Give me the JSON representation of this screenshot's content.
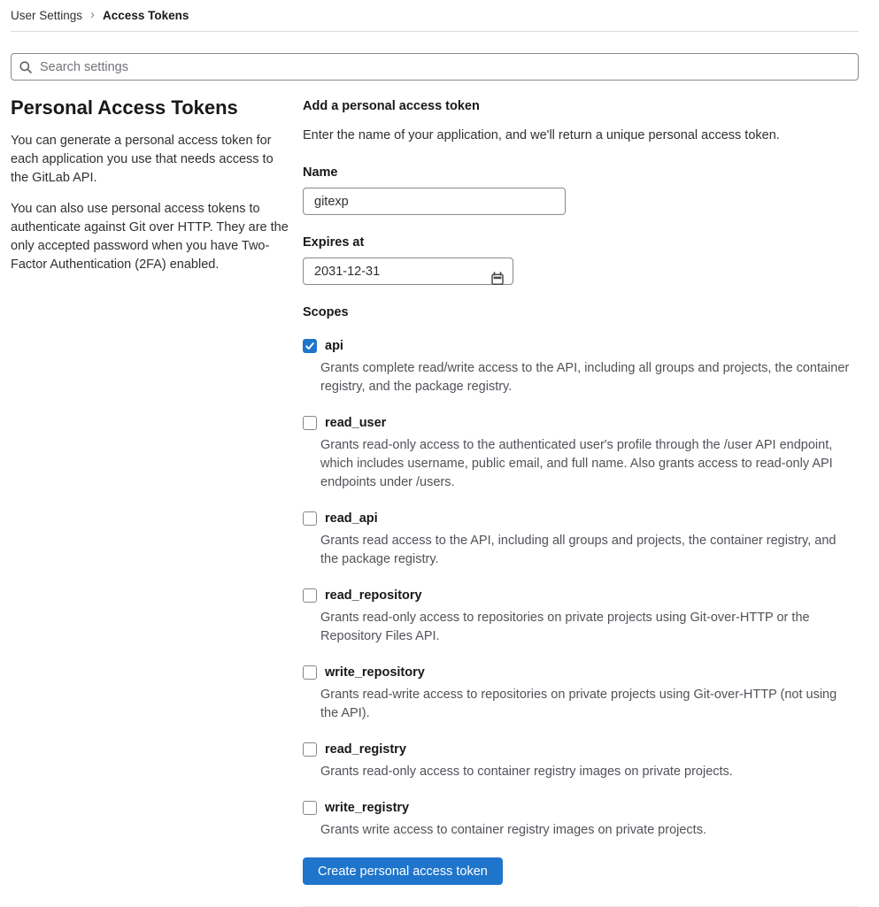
{
  "breadcrumb": {
    "separator": "›",
    "items": [
      {
        "label": "User Settings"
      },
      {
        "label": "Access Tokens"
      }
    ]
  },
  "search": {
    "placeholder": "Search settings"
  },
  "sidebar": {
    "title": "Personal Access Tokens",
    "paragraphs": [
      "You can generate a personal access token for each application you use that needs access to the GitLab API.",
      "You can also use personal access tokens to authenticate against Git over HTTP. They are the only accepted password when you have Two-Factor Authentication (2FA) enabled."
    ]
  },
  "form": {
    "title": "Add a personal access token",
    "description": "Enter the name of your application, and we'll return a unique personal access token.",
    "name_label": "Name",
    "name_value": "gitexp",
    "expires_label": "Expires at",
    "expires_value": "2031-12-31",
    "scopes_label": "Scopes",
    "scopes": [
      {
        "name": "api",
        "checked": true,
        "description": "Grants complete read/write access to the API, including all groups and projects, the container registry, and the package registry."
      },
      {
        "name": "read_user",
        "checked": false,
        "description": "Grants read-only access to the authenticated user's profile through the /user API endpoint, which includes username, public email, and full name. Also grants access to read-only API endpoints under /users."
      },
      {
        "name": "read_api",
        "checked": false,
        "description": "Grants read access to the API, including all groups and projects, the container registry, and the package registry."
      },
      {
        "name": "read_repository",
        "checked": false,
        "description": "Grants read-only access to repositories on private projects using Git-over-HTTP or the Repository Files API."
      },
      {
        "name": "write_repository",
        "checked": false,
        "description": "Grants read-write access to repositories on private projects using Git-over-HTTP (not using the API)."
      },
      {
        "name": "read_registry",
        "checked": false,
        "description": "Grants read-only access to container registry images on private projects."
      },
      {
        "name": "write_registry",
        "checked": false,
        "description": "Grants write access to container registry images on private projects."
      }
    ],
    "submit_label": "Create personal access token"
  },
  "colors": {
    "accent_blue": "#1f75cb",
    "divider": "#dbdbdb",
    "muted_text": "#535158"
  }
}
